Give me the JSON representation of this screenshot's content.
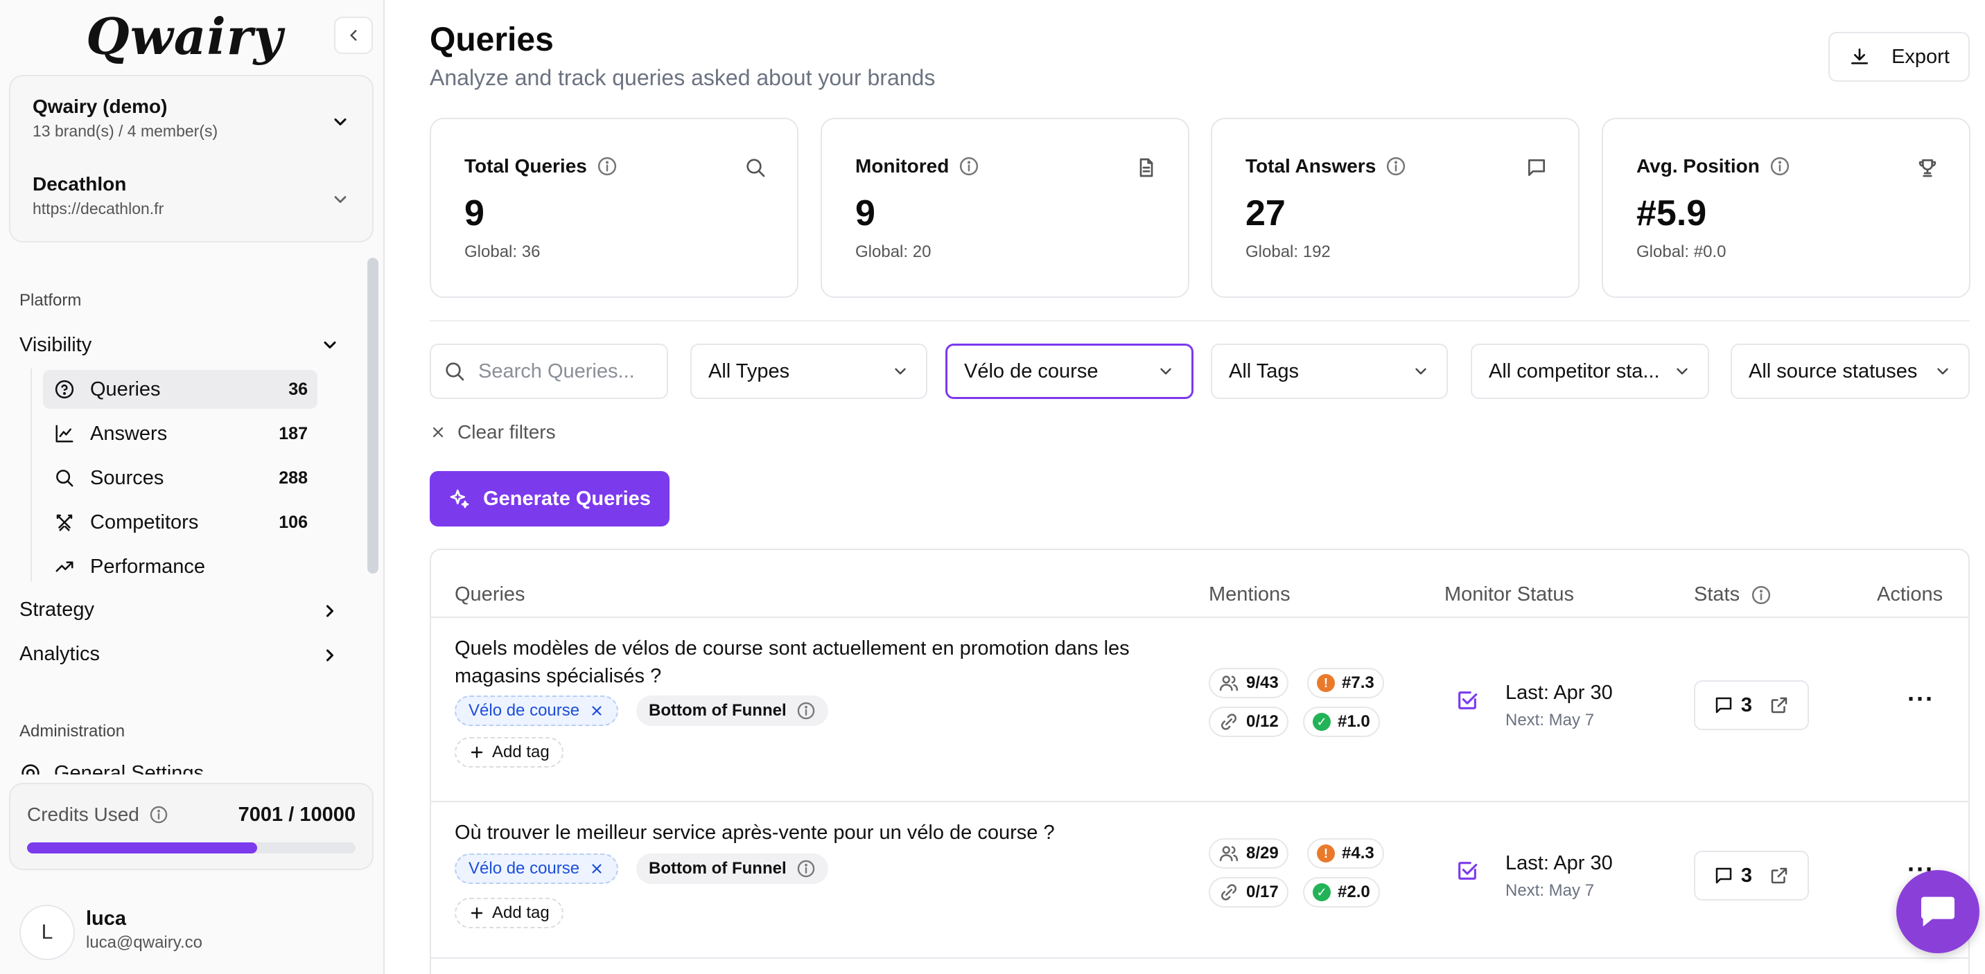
{
  "sidebar": {
    "logo": "Qwairy",
    "org": {
      "name": "Qwairy (demo)",
      "sub": "13 brand(s) / 4 member(s)"
    },
    "brand": {
      "name": "Decathlon",
      "url": "https://decathlon.fr"
    },
    "platform_label": "Platform",
    "visibility_label": "Visibility",
    "items": [
      {
        "label": "Queries",
        "count": "36",
        "icon": "help-circle-icon"
      },
      {
        "label": "Answers",
        "count": "187",
        "icon": "chart-line-icon"
      },
      {
        "label": "Sources",
        "count": "288",
        "icon": "search-icon"
      },
      {
        "label": "Competitors",
        "count": "106",
        "icon": "swords-icon"
      },
      {
        "label": "Performance",
        "count": "",
        "icon": "trending-up-icon"
      }
    ],
    "strategy_label": "Strategy",
    "analytics_label": "Analytics",
    "admin_label": "Administration",
    "admin_partial": "General Settings",
    "credits": {
      "label": "Credits Used",
      "value": "7001 / 10000",
      "used": 7001,
      "total": 10000
    },
    "user": {
      "initial": "L",
      "name": "luca",
      "email": "luca@qwairy.co"
    }
  },
  "header": {
    "title": "Queries",
    "subtitle": "Analyze and track queries asked about your brands",
    "export_label": "Export"
  },
  "stats": [
    {
      "title": "Total Queries",
      "value": "9",
      "global_label": "Global:",
      "global": "36",
      "icon": "search-icon"
    },
    {
      "title": "Monitored",
      "value": "9",
      "global_label": "Global:",
      "global": "20",
      "icon": "document-icon"
    },
    {
      "title": "Total Answers",
      "value": "27",
      "global_label": "Global:",
      "global": "192",
      "icon": "message-icon"
    },
    {
      "title": "Avg. Position",
      "value": "#5.9",
      "global_label": "Global:",
      "global": "#0.0",
      "icon": "trophy-icon"
    }
  ],
  "filters": {
    "search_placeholder": "Search Queries...",
    "types": "All Types",
    "topic": "Vélo de course",
    "tags": "All Tags",
    "competitor": "All competitor sta...",
    "source": "All source statuses",
    "clear_label": "Clear filters"
  },
  "generate_label": "Generate Queries",
  "table": {
    "columns": [
      "Queries",
      "Mentions",
      "Monitor Status",
      "Stats",
      "Actions"
    ],
    "rows": [
      {
        "query": "Quels modèles de vélos de course sont actuellement en promotion dans les magasins spécialisés ?",
        "topic_tag": "Vélo de course",
        "funnel_tag": "Bottom of Funnel",
        "add_tag": "Add tag",
        "mentions": "9/43",
        "position": "#7.3",
        "links": "0/12",
        "link_position": "#1.0",
        "last": "Last: Apr 30",
        "next": "Next: May 7",
        "answers": "3"
      },
      {
        "query": "Où trouver le meilleur service après-vente pour un vélo de course ?",
        "topic_tag": "Vélo de course",
        "funnel_tag": "Bottom of Funnel",
        "add_tag": "Add tag",
        "mentions": "8/29",
        "position": "#4.3",
        "links": "0/17",
        "link_position": "#2.0",
        "last": "Last: Apr 30",
        "next": "Next: May 7",
        "answers": "3"
      }
    ]
  },
  "colors": {
    "accent": "#7c3aed",
    "warning": "#ea7a2b",
    "success": "#22b357"
  }
}
